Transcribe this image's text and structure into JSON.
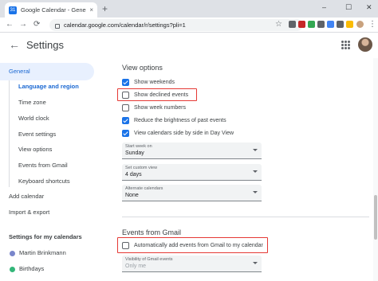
{
  "browser": {
    "tab_title": "Google Calendar - General setti",
    "tab_favicon_text": "31",
    "url": "calendar.google.com/calendar/r/settings?pli=1",
    "icons": {
      "new_tab": "+",
      "close_tab": "×",
      "minimize": "–",
      "maximize": "☐",
      "close_window": "✕",
      "back": "←",
      "forward": "→",
      "reload": "⟳",
      "star": "☆",
      "menu": "⋮"
    },
    "extension_colors": [
      "#5f6368",
      "#c62828",
      "#34a853",
      "#5f6368",
      "#4285f4",
      "#5f6368",
      "#fbbc04"
    ]
  },
  "header": {
    "back_icon": "←",
    "title": "Settings"
  },
  "sidebar": {
    "general": "General",
    "sub_items": [
      {
        "label": "Language and region",
        "active": true
      },
      {
        "label": "Time zone"
      },
      {
        "label": "World clock"
      },
      {
        "label": "Event settings"
      },
      {
        "label": "View options"
      },
      {
        "label": "Events from Gmail"
      },
      {
        "label": "Keyboard shortcuts"
      }
    ],
    "add_calendar": "Add calendar",
    "import_export": "Import & export",
    "my_calendars_heading": "Settings for my calendars",
    "calendars": [
      {
        "name": "Martin Brinkmann",
        "color": "#7986cb"
      },
      {
        "name": "Birthdays",
        "color": "#33b679"
      }
    ]
  },
  "view_options": {
    "title": "View options",
    "checkboxes": [
      {
        "label": "Show weekends",
        "checked": true
      },
      {
        "label": "Show declined events",
        "checked": false,
        "highlighted": true
      },
      {
        "label": "Show week numbers",
        "checked": false
      },
      {
        "label": "Reduce the brightness of past events",
        "checked": true
      },
      {
        "label": "View calendars side by side in Day View",
        "checked": true
      }
    ],
    "dropdowns": [
      {
        "label": "Start week on",
        "value": "Sunday"
      },
      {
        "label": "Set custom view",
        "value": "4 days"
      },
      {
        "label": "Alternate calendars",
        "value": "None"
      }
    ]
  },
  "events_from_gmail": {
    "title": "Events from Gmail",
    "checkbox": {
      "label": "Automatically add events from Gmail to my calendar",
      "checked": false,
      "highlighted": true
    },
    "dropdown": {
      "label": "Visibility of Gmail events",
      "value": "Only me"
    }
  },
  "colors": {
    "accent": "#1a73e8",
    "highlight_box": "#e53935",
    "active_nav_bg": "#e8f0fe"
  }
}
